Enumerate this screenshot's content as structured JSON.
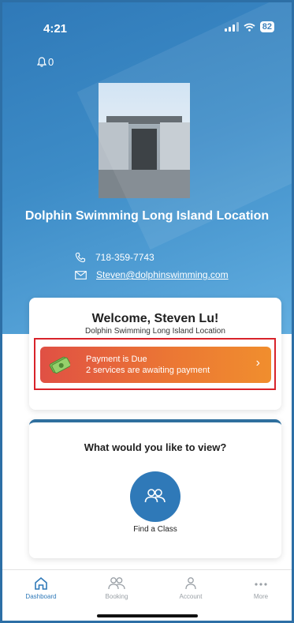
{
  "status_bar": {
    "time": "4:21",
    "battery": "82"
  },
  "notifications": {
    "count": "0"
  },
  "location": {
    "name": "Dolphin Swimming Long Island Location"
  },
  "contact": {
    "phone": "718-359-7743",
    "email": "Steven@dolphinswimming.com"
  },
  "welcome": {
    "title": "Welcome, Steven Lu!",
    "subtitle": "Dolphin Swimming Long Island Location"
  },
  "payment": {
    "title": "Payment is Due",
    "message": "2 services are awaiting payment",
    "chevron": "›"
  },
  "view_section": {
    "title": "What would you like to view?",
    "option_label": "Find a Class"
  },
  "tabbar": {
    "items": [
      {
        "label": "Dashboard",
        "icon": "home-icon"
      },
      {
        "label": "Booking",
        "icon": "people-icon"
      },
      {
        "label": "Account",
        "icon": "person-icon"
      },
      {
        "label": "More",
        "icon": "more-icon"
      }
    ],
    "active": "Dashboard"
  },
  "colors": {
    "brand_blue": "#2f79b8",
    "payment_start": "#e05044",
    "payment_end": "#f08e2e",
    "highlight_red": "#d8232a"
  }
}
